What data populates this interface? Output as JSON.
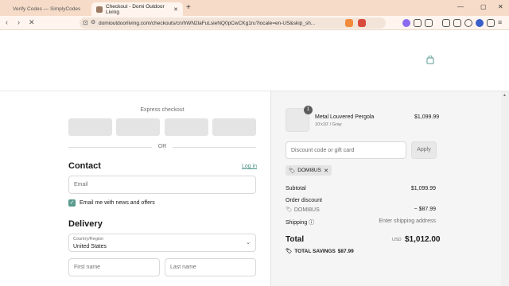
{
  "browser": {
    "tabs": [
      {
        "title": "Verify Codes — SimplyCodes",
        "active": false
      },
      {
        "title": "Checkout - Domi Outdoor Living",
        "active": true
      }
    ],
    "url": "domioutdoorliving.com/checkouts/cn/hWN2laFuLsieNQ0pCwCKg1ru?locale=en-US&skip_sh...",
    "accent_color": "#f6dcc8"
  },
  "checkout": {
    "express_label": "Express checkout",
    "or_label": "OR",
    "contact_heading": "Contact",
    "login_link": "Log in",
    "email_placeholder": "Email",
    "newsletter_label": "Email me with news and offers",
    "newsletter_checked": true,
    "delivery_heading": "Delivery",
    "country_label": "Country/Region",
    "country_value": "United States",
    "first_name_placeholder": "First name",
    "last_name_placeholder": "Last name"
  },
  "summary": {
    "product": {
      "quantity": "1",
      "name": "Metal Louvered Pergola",
      "variant": "10'x10' / Gray",
      "price": "$1,099.99"
    },
    "discount_placeholder": "Discount code or gift card",
    "apply_label": "Apply",
    "applied_code": "DOMI8US",
    "subtotal_label": "Subtotal",
    "subtotal_value": "$1,099.99",
    "order_discount_label": "Order discount",
    "discount_code": "DOMI8US",
    "discount_value": "− $87.99",
    "shipping_label": "Shipping",
    "shipping_value": "Enter shipping address",
    "total_label": "Total",
    "currency": "USD",
    "total_value": "$1,012.00",
    "savings_label": "TOTAL SAVINGS",
    "savings_value": "$87.99"
  },
  "icons": {
    "brand_accent": "#5a9b8f"
  }
}
